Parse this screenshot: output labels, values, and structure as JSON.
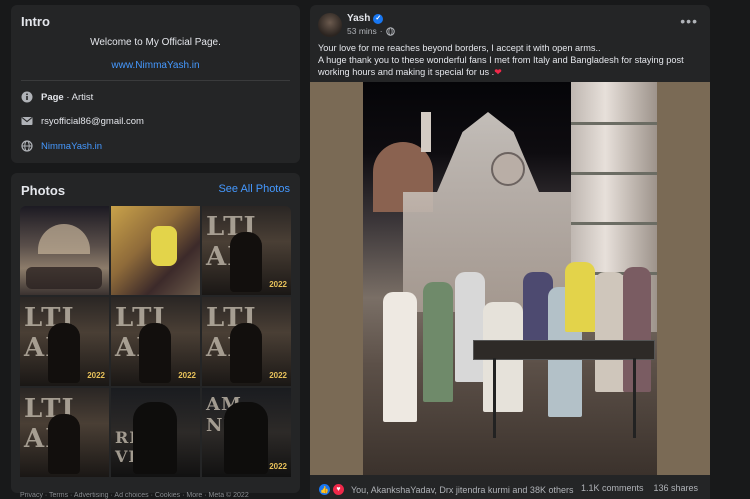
{
  "intro": {
    "title": "Intro",
    "bio": "Welcome to My Official Page.",
    "link": "www.NimmaYash.in",
    "category_label": "Page",
    "category_value": " · Artist",
    "email": "rsyofficial86@gmail.com",
    "website": "NimmaYash.in",
    "icons": [
      "info-icon",
      "mail-icon",
      "globe-icon"
    ]
  },
  "photos": {
    "title": "Photos",
    "see_all": "See All Photos",
    "tiles": [
      {
        "overlay": "",
        "year": ""
      },
      {
        "overlay": "",
        "year": ""
      },
      {
        "overlay": "LTI AI",
        "year": "2022"
      },
      {
        "overlay": "LTI AI",
        "year": "2022"
      },
      {
        "overlay": "LTI AI",
        "year": "2022"
      },
      {
        "overlay": "LTI AI",
        "year": "2022"
      },
      {
        "overlay": "LTI AI",
        "year": ""
      },
      {
        "overlay": "RIL VIDE",
        "year": ""
      },
      {
        "overlay": "AM NEE",
        "year": "2022"
      }
    ]
  },
  "post": {
    "author": "Yash",
    "verified": true,
    "time": "53 mins",
    "audience_icon": "globe-icon",
    "more_label": "•••",
    "line1": "Your love for me reaches beyond borders, I accept it with open arms..",
    "line2": "A huge thank you to these wonderful fans I met from Italy and Bangladesh for staying post working hours and making it special for us .",
    "heart": "❤",
    "reactions_text": "You, AkankshaYadav, Drx jitendra kurmi and 38K others",
    "comments": "1.1K comments",
    "shares": "136 shares",
    "colors": {
      "accent": "#4599ff",
      "like": "#1877f2",
      "love": "#f02849"
    }
  },
  "footer": {
    "text": "Privacy · Terms · Advertising · Ad choices · Cookies · More · Meta © 2022"
  }
}
